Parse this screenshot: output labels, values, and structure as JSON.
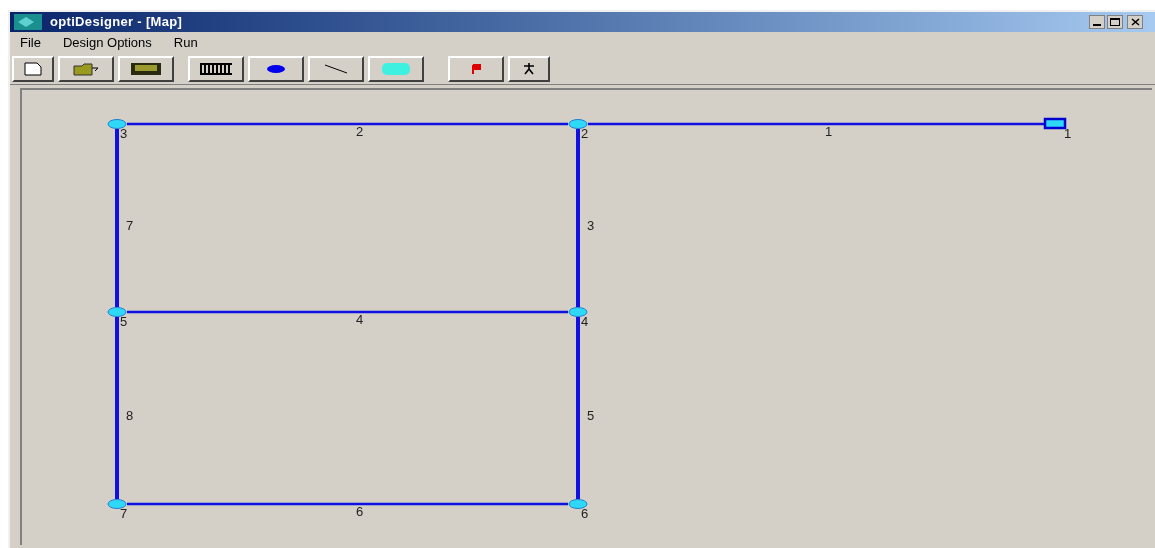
{
  "window": {
    "title": "optiDesigner - [Map]"
  },
  "menu": [
    "File",
    "Design Options",
    "Run"
  ],
  "map": {
    "nodes": [
      {
        "label": "3",
        "kind": "junction"
      },
      {
        "label": "2",
        "kind": "junction"
      },
      {
        "label": "1",
        "kind": "reservoir"
      },
      {
        "label": "5",
        "kind": "junction"
      },
      {
        "label": "4",
        "kind": "junction"
      },
      {
        "label": "7",
        "kind": "junction"
      },
      {
        "label": "6",
        "kind": "junction"
      }
    ],
    "pipes": [
      {
        "label": "2"
      },
      {
        "label": "1"
      },
      {
        "label": "7"
      },
      {
        "label": "3"
      },
      {
        "label": "4"
      },
      {
        "label": "8"
      },
      {
        "label": "5"
      },
      {
        "label": "6"
      }
    ]
  }
}
